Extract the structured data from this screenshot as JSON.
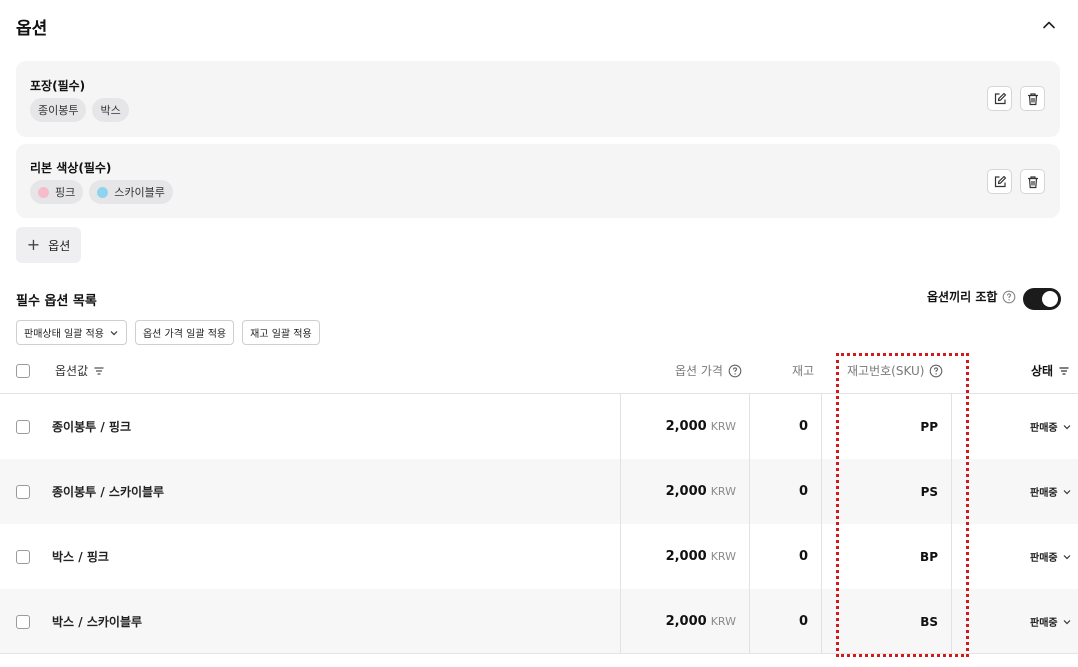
{
  "section": {
    "title": "옵션"
  },
  "option_groups": [
    {
      "name": "포장(필수)",
      "values": [
        {
          "label": "종이봉투"
        },
        {
          "label": "박스"
        }
      ]
    },
    {
      "name": "리본 색상(필수)",
      "values": [
        {
          "label": "핑크",
          "color": "#f6bccb"
        },
        {
          "label": "스카이블루",
          "color": "#8fd3ee"
        }
      ]
    }
  ],
  "add_option_label": "옵션",
  "list": {
    "title": "필수 옵션 목록",
    "combine_label": "옵션끼리 조합",
    "combine_enabled": true
  },
  "bulk_actions": [
    "판매상태 일괄 적용",
    "옵션 가격 일괄 적용",
    "재고 일괄 적용"
  ],
  "table": {
    "headers": {
      "option_value": "옵션값",
      "price": "옵션 가격",
      "stock": "재고",
      "sku": "재고번호(SKU)",
      "status": "상태"
    },
    "rows": [
      {
        "name": "종이봉투 / 핑크",
        "price": "2,000",
        "currency": "KRW",
        "stock": "0",
        "sku": "PP",
        "status": "판매중"
      },
      {
        "name": "종이봉투 / 스카이블루",
        "price": "2,000",
        "currency": "KRW",
        "stock": "0",
        "sku": "PS",
        "status": "판매중"
      },
      {
        "name": "박스 / 핑크",
        "price": "2,000",
        "currency": "KRW",
        "stock": "0",
        "sku": "BP",
        "status": "판매중"
      },
      {
        "name": "박스 / 스카이블루",
        "price": "2,000",
        "currency": "KRW",
        "stock": "0",
        "sku": "BS",
        "status": "판매중"
      }
    ]
  },
  "colors": {
    "highlight": "#d11a1a",
    "toggle_on": "#1b1b1b"
  }
}
